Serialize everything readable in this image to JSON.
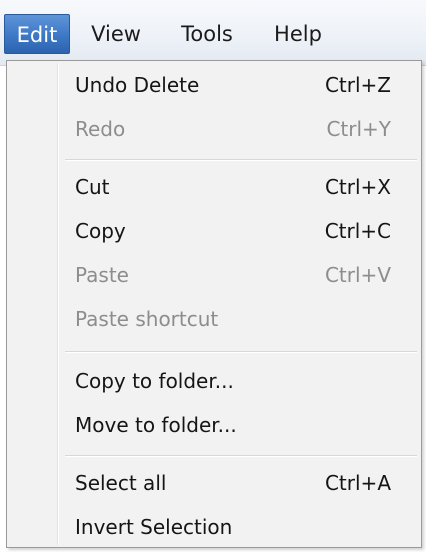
{
  "menubar": {
    "items": [
      {
        "label": "Edit",
        "active": true
      },
      {
        "label": "View",
        "active": false
      },
      {
        "label": "Tools",
        "active": false
      },
      {
        "label": "Help",
        "active": false
      }
    ]
  },
  "edit_menu": {
    "undo": {
      "label": "Undo Delete",
      "shortcut": "Ctrl+Z",
      "enabled": true
    },
    "redo": {
      "label": "Redo",
      "shortcut": "Ctrl+Y",
      "enabled": false
    },
    "cut": {
      "label": "Cut",
      "shortcut": "Ctrl+X",
      "enabled": true
    },
    "copy": {
      "label": "Copy",
      "shortcut": "Ctrl+C",
      "enabled": true
    },
    "paste": {
      "label": "Paste",
      "shortcut": "Ctrl+V",
      "enabled": false
    },
    "paste_shortcut": {
      "label": "Paste shortcut",
      "enabled": false
    },
    "copy_to_folder": {
      "label": "Copy to folder...",
      "enabled": true
    },
    "move_to_folder": {
      "label": "Move to folder...",
      "enabled": true
    },
    "select_all": {
      "label": "Select all",
      "shortcut": "Ctrl+A",
      "enabled": true
    },
    "invert_selection": {
      "label": "Invert Selection",
      "enabled": true
    }
  },
  "colors": {
    "active_menu_bg": "#3d78c6",
    "active_menu_text": "#ffffff",
    "menu_bg": "#f2f2f2",
    "disabled_text": "#8d8d8d"
  }
}
